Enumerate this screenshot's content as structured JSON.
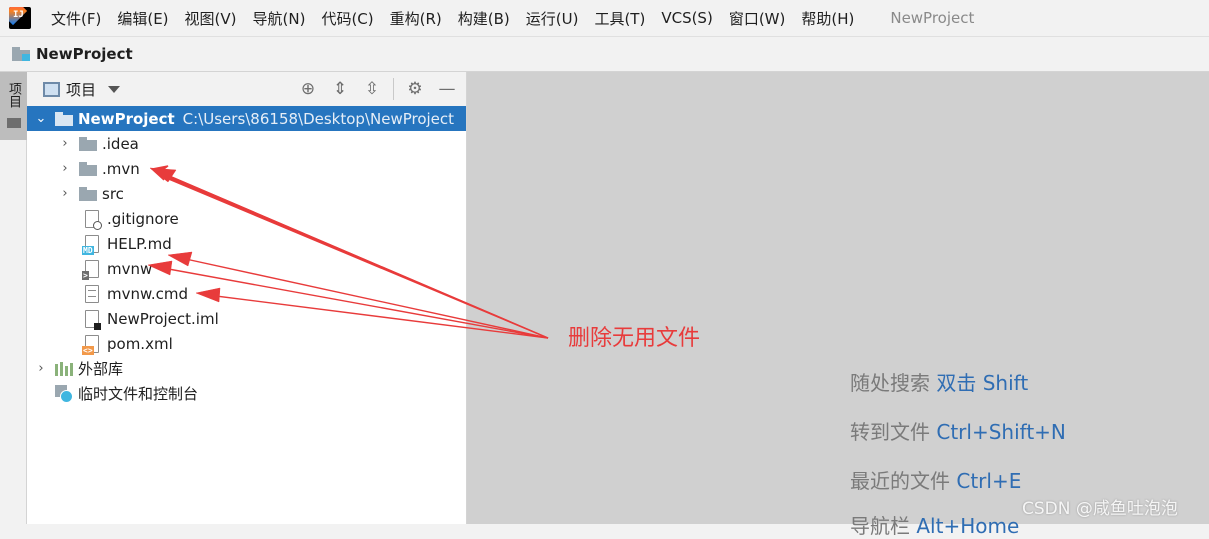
{
  "menubar": {
    "items": [
      "文件(F)",
      "编辑(E)",
      "视图(V)",
      "导航(N)",
      "代码(C)",
      "重构(R)",
      "构建(B)",
      "运行(U)",
      "工具(T)",
      "VCS(S)",
      "窗口(W)",
      "帮助(H)"
    ],
    "title": "NewProject"
  },
  "navbar": {
    "project": "NewProject"
  },
  "toolstrip": {
    "project_label": "项目"
  },
  "panel": {
    "title": "项目"
  },
  "tree": {
    "root": {
      "name": "NewProject",
      "path": "C:\\Users\\86158\\Desktop\\NewProject"
    },
    "items": [
      {
        "name": ".idea",
        "icon": "folder-icon"
      },
      {
        "name": ".mvn",
        "icon": "folder-icon"
      },
      {
        "name": "src",
        "icon": "folder-icon"
      },
      {
        "name": ".gitignore",
        "icon": "gitignore-file-icon"
      },
      {
        "name": "HELP.md",
        "icon": "markdown-file-icon"
      },
      {
        "name": "mvnw",
        "icon": "shell-file-icon"
      },
      {
        "name": "mvnw.cmd",
        "icon": "text-file-icon"
      },
      {
        "name": "NewProject.iml",
        "icon": "iml-file-icon"
      },
      {
        "name": "pom.xml",
        "icon": "xml-file-icon"
      }
    ],
    "external_libraries": "外部库",
    "scratches": "临时文件和控制台"
  },
  "editor_hints": [
    {
      "label": "随处搜索",
      "key": "双击 Shift"
    },
    {
      "label": "转到文件",
      "key": "Ctrl+Shift+N"
    },
    {
      "label": "最近的文件",
      "key": "Ctrl+E"
    },
    {
      "label": "导航栏",
      "key": "Alt+Home"
    }
  ],
  "annotation": {
    "text": "删除无用文件",
    "color": "#e83b3b"
  },
  "watermark": "CSDN @咸鱼吐泡泡",
  "colors": {
    "selection": "#2675bf",
    "editor_bg": "#d0d0d0",
    "shortcut": "#2f6db3"
  }
}
